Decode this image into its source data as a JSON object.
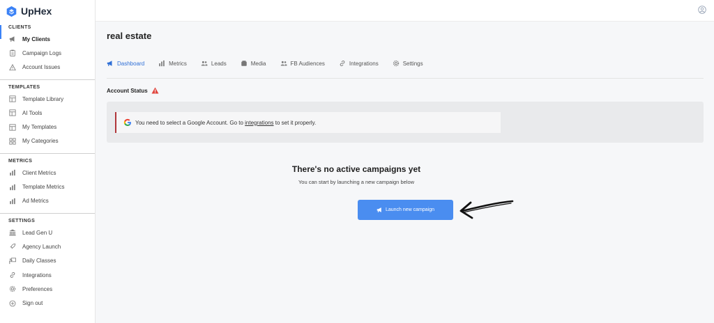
{
  "brand": {
    "name": "UpHex",
    "color": "#3b82f6"
  },
  "sidebar": {
    "sections": [
      {
        "title": "CLIENTS",
        "items": [
          {
            "label": "My Clients",
            "icon": "megaphone-icon",
            "active": true
          },
          {
            "label": "Campaign Logs",
            "icon": "clipboard-icon"
          },
          {
            "label": "Account Issues",
            "icon": "warning-icon"
          }
        ]
      },
      {
        "title": "TEMPLATES",
        "items": [
          {
            "label": "Template Library",
            "icon": "layout-icon"
          },
          {
            "label": "AI Tools",
            "icon": "layout-icon"
          },
          {
            "label": "My Templates",
            "icon": "layout-icon"
          },
          {
            "label": "My Categories",
            "icon": "grid-icon"
          }
        ]
      },
      {
        "title": "METRICS",
        "items": [
          {
            "label": "Client Metrics",
            "icon": "bar-chart-icon"
          },
          {
            "label": "Template Metrics",
            "icon": "bar-chart-icon"
          },
          {
            "label": "Ad Metrics",
            "icon": "bar-chart-icon"
          }
        ]
      },
      {
        "title": "SETTINGS",
        "items": [
          {
            "label": "Lead Gen U",
            "icon": "university-icon"
          },
          {
            "label": "Agency Launch",
            "icon": "rocket-icon"
          },
          {
            "label": "Daily Classes",
            "icon": "chalkboard-icon"
          },
          {
            "label": "Integrations",
            "icon": "link-icon"
          },
          {
            "label": "Preferences",
            "icon": "gear-icon"
          },
          {
            "label": "Sign out",
            "icon": "signout-icon"
          }
        ]
      }
    ]
  },
  "main": {
    "title": "real estate",
    "tabs": [
      {
        "label": "Dashboard",
        "icon": "megaphone-icon",
        "active": true
      },
      {
        "label": "Metrics",
        "icon": "bar-chart-icon"
      },
      {
        "label": "Leads",
        "icon": "users-icon"
      },
      {
        "label": "Media",
        "icon": "media-icon"
      },
      {
        "label": "FB Audiences",
        "icon": "users-icon"
      },
      {
        "label": "Integrations",
        "icon": "link-icon"
      },
      {
        "label": "Settings",
        "icon": "gear-icon"
      }
    ],
    "account_status_label": "Account Status",
    "alert": {
      "text_before": "You need to select a Google Account. Go to ",
      "link_text": "integrations",
      "text_after": " to set it properly.",
      "accent_color": "#b0363a"
    },
    "empty_state": {
      "title": "There's no active campaigns yet",
      "subtitle": "You can start by launching a new campaign below",
      "button_label": "Launch new campaign",
      "button_color": "#4a8df0"
    }
  }
}
